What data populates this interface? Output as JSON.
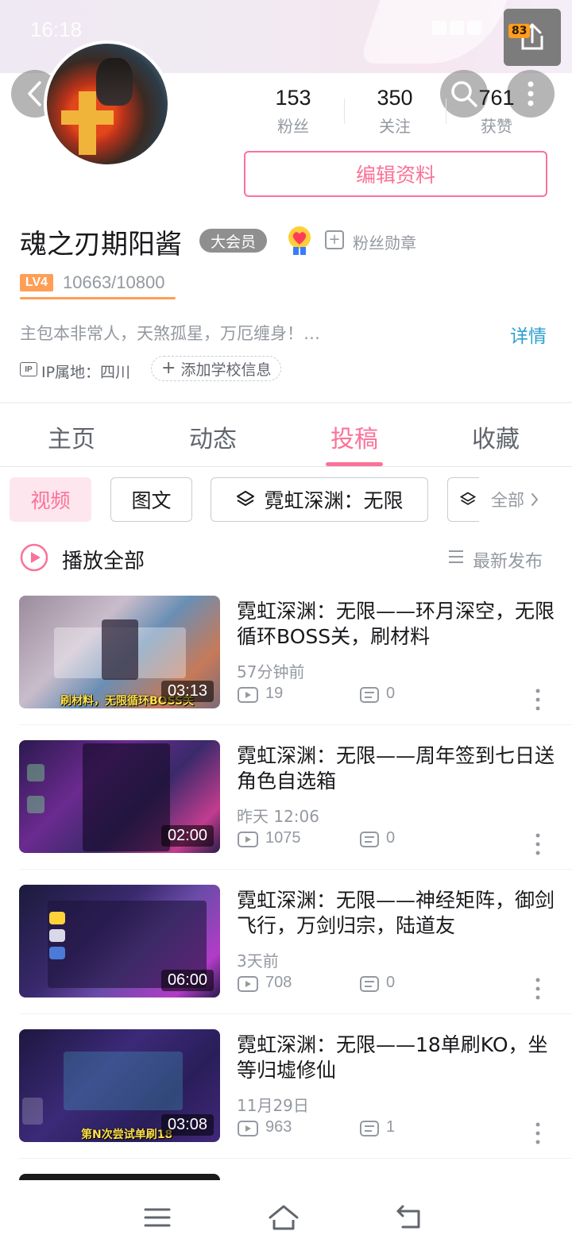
{
  "status_bar": {
    "time": "16:18"
  },
  "share": {
    "badge": "83"
  },
  "profile": {
    "username": "魂之刃期阳酱",
    "vip_label": "大会员",
    "fan_medal_label": "粉丝勋章",
    "level_badge": "LV4",
    "exp": "10663/10800",
    "exp_progress": 0.987,
    "signature": "主包本非常人，天煞孤星，万厄缠身！…",
    "detail_link": "详情",
    "ip_location": "IP属地：四川",
    "add_school": "添加学校信息",
    "edit_button": "编辑资料"
  },
  "stats": [
    {
      "value": "153",
      "label": "粉丝"
    },
    {
      "value": "350",
      "label": "关注"
    },
    {
      "value": "761",
      "label": "获赞"
    }
  ],
  "tabs": [
    {
      "label": "主页",
      "active": false
    },
    {
      "label": "动态",
      "active": false
    },
    {
      "label": "投稿",
      "active": true
    },
    {
      "label": "收藏",
      "active": false
    }
  ],
  "filters": {
    "video": "视频",
    "image_text": "图文",
    "collection": "霓虹深渊：无限",
    "all": "全部"
  },
  "list_header": {
    "play_all": "播放全部",
    "sort": "最新发布"
  },
  "videos": [
    {
      "title": "霓虹深渊：无限——环月深空，无限循环BOSS关，刷材料",
      "caption": "刷材料，无限循环BOSS关",
      "duration": "03:13",
      "time": "57分钟前",
      "views": "19",
      "danmaku": "0"
    },
    {
      "title": "霓虹深渊：无限——周年签到七日送角色自选箱",
      "caption": "",
      "duration": "02:00",
      "time": "昨天 12:06",
      "views": "1075",
      "danmaku": "0"
    },
    {
      "title": "霓虹深渊：无限——神经矩阵，御剑飞行，万剑归宗，陆道友",
      "caption": "",
      "duration": "06:00",
      "time": "3天前",
      "views": "708",
      "danmaku": "0"
    },
    {
      "title": "霓虹深渊：无限——18单刷KO，坐等归墟修仙",
      "caption": "第N次尝试单刷18",
      "duration": "03:08",
      "time": "11月29日",
      "views": "963",
      "danmaku": "1"
    }
  ],
  "colors": {
    "accent": "#fb7299",
    "link": "#2d9fd0",
    "level": "#ff9e56",
    "secondary_text": "#9499a0"
  }
}
